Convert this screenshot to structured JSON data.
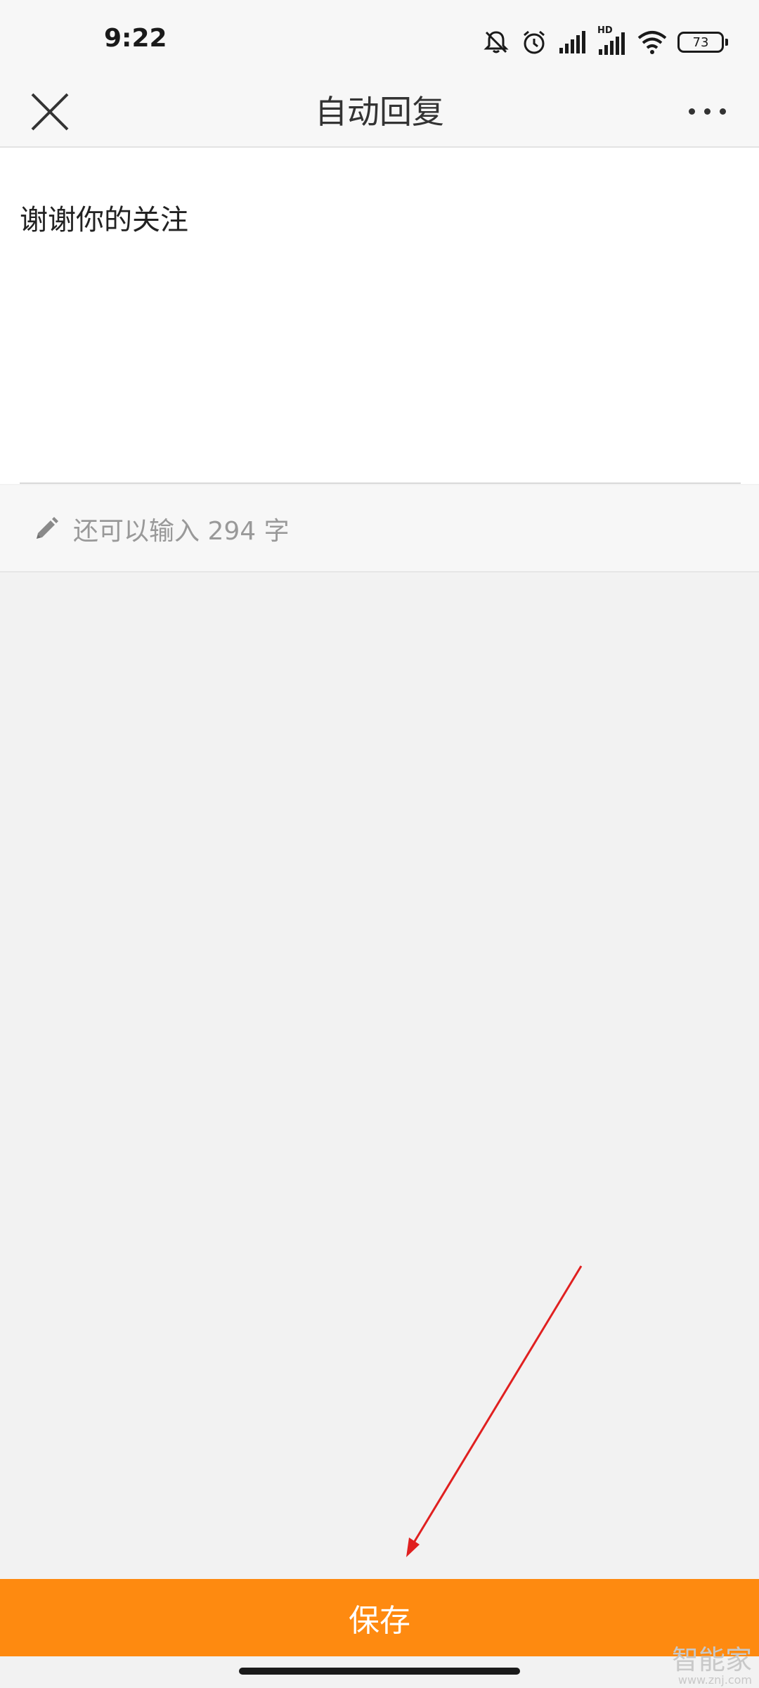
{
  "status_bar": {
    "time": "9:22",
    "battery_level": "73",
    "network_badge": "HD",
    "icons": [
      "bell-off-icon",
      "alarm-clock-icon",
      "signal-icon",
      "hd-signal-icon",
      "wifi-icon",
      "battery-icon"
    ]
  },
  "nav": {
    "title": "自动回复",
    "close_icon": "close-icon",
    "more_icon": "more-dots-icon"
  },
  "editor": {
    "text": "谢谢你的关注",
    "counter": "还可以输入 294 字",
    "counter_icon": "pencil-icon"
  },
  "footer": {
    "save_label": "保存"
  },
  "watermark": {
    "main": "智能家",
    "sub": "www.znj.com"
  },
  "colors": {
    "accent": "#fe8a10",
    "background": "#f2f2f2",
    "annotation_arrow": "#e02020"
  }
}
